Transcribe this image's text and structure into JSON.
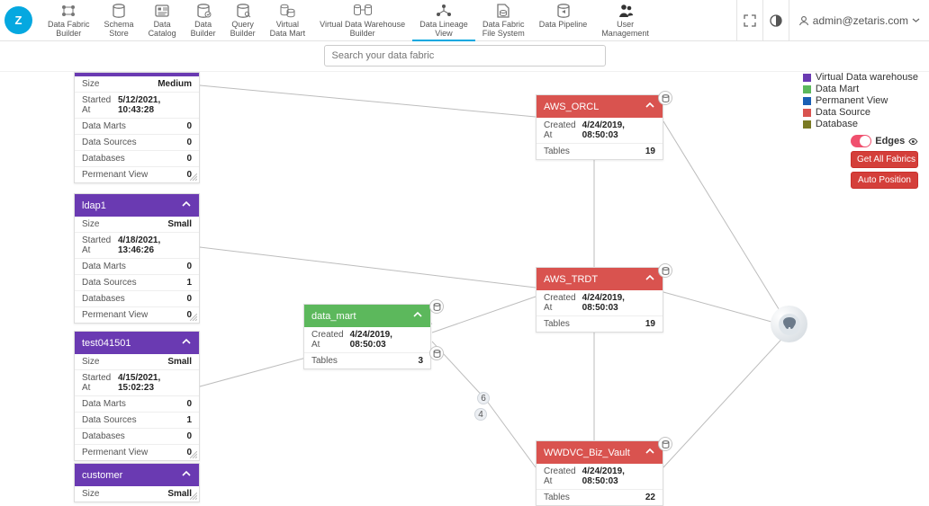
{
  "nav": [
    {
      "l1": "Data Fabric",
      "l2": "Builder"
    },
    {
      "l1": "Schema",
      "l2": "Store"
    },
    {
      "l1": "Data",
      "l2": "Catalog"
    },
    {
      "l1": "Data",
      "l2": "Builder"
    },
    {
      "l1": "Query",
      "l2": "Builder"
    },
    {
      "l1": "Virtual",
      "l2": "Data Mart"
    },
    {
      "l1": "Virtual Data Warehouse",
      "l2": "Builder"
    },
    {
      "l1": "Data Lineage",
      "l2": "View"
    },
    {
      "l1": "Data Fabric",
      "l2": "File System"
    },
    {
      "l1": "Data Pipeline",
      "l2": ""
    },
    {
      "l1": "User",
      "l2": "Management"
    }
  ],
  "active_nav_index": 7,
  "user_email": "admin@zetaris.com",
  "search_placeholder": "Search your data fabric",
  "legend": [
    {
      "color": "#6a3ab2",
      "label": "Virtual Data warehouse"
    },
    {
      "color": "#5cb85c",
      "label": "Data Mart"
    },
    {
      "color": "#1a5fb4",
      "label": "Permanent View"
    },
    {
      "color": "#d9534f",
      "label": "Data Source"
    },
    {
      "color": "#7a7a24",
      "label": "Database"
    }
  ],
  "controls": {
    "edges_label": "Edges",
    "get_fabrics": "Get All Fabrics",
    "auto_position": "Auto Position"
  },
  "badges": {
    "a": "6",
    "b": "4"
  },
  "purple_nodes": [
    {
      "title_hidden": true,
      "rows": [
        {
          "k": "Size",
          "v": "Medium"
        },
        {
          "k": "Started At",
          "v": "5/12/2021, 10:43:28"
        },
        {
          "k": "Data Marts",
          "v": "0"
        },
        {
          "k": "Data Sources",
          "v": "0"
        },
        {
          "k": "Databases",
          "v": "0"
        },
        {
          "k": "Permenant View",
          "v": "0"
        }
      ]
    },
    {
      "title": "ldap1",
      "rows": [
        {
          "k": "Size",
          "v": "Small"
        },
        {
          "k": "Started At",
          "v": "4/18/2021, 13:46:26"
        },
        {
          "k": "Data Marts",
          "v": "0"
        },
        {
          "k": "Data Sources",
          "v": "1"
        },
        {
          "k": "Databases",
          "v": "0"
        },
        {
          "k": "Permenant View",
          "v": "0"
        }
      ]
    },
    {
      "title": "test041501",
      "rows": [
        {
          "k": "Size",
          "v": "Small"
        },
        {
          "k": "Started At",
          "v": "4/15/2021, 15:02:23"
        },
        {
          "k": "Data Marts",
          "v": "0"
        },
        {
          "k": "Data Sources",
          "v": "1"
        },
        {
          "k": "Databases",
          "v": "0"
        },
        {
          "k": "Permenant View",
          "v": "0"
        }
      ]
    },
    {
      "title": "customer",
      "rows": [
        {
          "k": "Size",
          "v": "Small"
        }
      ]
    }
  ],
  "red_nodes": [
    {
      "title": "AWS_ORCL",
      "rows": [
        {
          "k": "Created At",
          "v": "4/24/2019, 08:50:03"
        },
        {
          "k": "Tables",
          "v": "19"
        }
      ]
    },
    {
      "title": "AWS_TRDT",
      "rows": [
        {
          "k": "Created At",
          "v": "4/24/2019, 08:50:03"
        },
        {
          "k": "Tables",
          "v": "19"
        }
      ]
    },
    {
      "title": "WWDVC_Biz_Vault",
      "rows": [
        {
          "k": "Created At",
          "v": "4/24/2019, 08:50:03"
        },
        {
          "k": "Tables",
          "v": "22"
        }
      ]
    }
  ],
  "green_nodes": [
    {
      "title": "data_mart",
      "rows": [
        {
          "k": "Created At",
          "v": "4/24/2019, 08:50:03"
        },
        {
          "k": "Tables",
          "v": "3"
        }
      ]
    }
  ]
}
